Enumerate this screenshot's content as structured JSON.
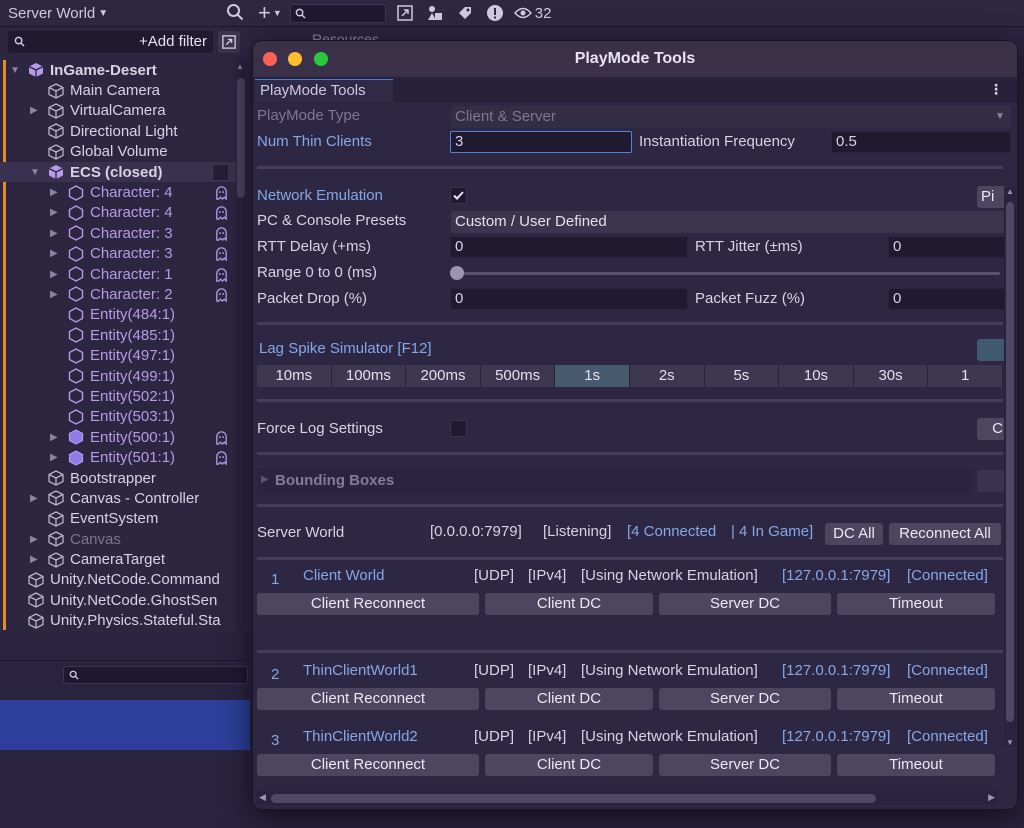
{
  "hierarchy": {
    "world_title": "Server World",
    "add_filter": "+Add filter",
    "items": [
      {
        "label": "InGame-Desert",
        "kind": "scene"
      },
      {
        "label": "Main Camera",
        "kind": "object"
      },
      {
        "label": "VirtualCamera",
        "kind": "object"
      },
      {
        "label": "Directional Light",
        "kind": "object"
      },
      {
        "label": "Global Volume",
        "kind": "object"
      },
      {
        "label": "ECS  (closed)",
        "kind": "subscene"
      },
      {
        "label": "Character: 4",
        "kind": "entity"
      },
      {
        "label": "Character: 4",
        "kind": "entity"
      },
      {
        "label": "Character: 3",
        "kind": "entity"
      },
      {
        "label": "Character: 3",
        "kind": "entity"
      },
      {
        "label": "Character: 1",
        "kind": "entity"
      },
      {
        "label": "Character: 2",
        "kind": "entity"
      },
      {
        "label": "Entity(484:1)",
        "kind": "entity"
      },
      {
        "label": "Entity(485:1)",
        "kind": "entity"
      },
      {
        "label": "Entity(497:1)",
        "kind": "entity"
      },
      {
        "label": "Entity(499:1)",
        "kind": "entity"
      },
      {
        "label": "Entity(502:1)",
        "kind": "entity"
      },
      {
        "label": "Entity(503:1)",
        "kind": "entity"
      },
      {
        "label": "Entity(500:1)",
        "kind": "entity"
      },
      {
        "label": "Entity(501:1)",
        "kind": "entity"
      },
      {
        "label": "Bootstrapper",
        "kind": "object"
      },
      {
        "label": "Canvas - Controller",
        "kind": "object"
      },
      {
        "label": "EventSystem",
        "kind": "object"
      },
      {
        "label": "Canvas",
        "kind": "object"
      },
      {
        "label": "CameraTarget",
        "kind": "object"
      },
      {
        "label": "Unity.NetCode.Command",
        "kind": "object"
      },
      {
        "label": "Unity.NetCode.GhostSen",
        "kind": "object"
      },
      {
        "label": "Unity.Physics.Stateful.Sta",
        "kind": "object"
      }
    ]
  },
  "toolbar": {
    "count": "32",
    "resources_label": "Resources"
  },
  "window": {
    "title": "PlayMode Tools",
    "tab": "PlayMode Tools"
  },
  "playmode": {
    "type_label": "PlayMode Type",
    "type_value": "Client & Server",
    "num_thin_label": "Num Thin Clients",
    "num_thin_value": "3",
    "inst_freq_label": "Instantiation Frequency",
    "inst_freq_value": "0.5"
  },
  "network": {
    "emulation_label": "Network Emulation",
    "emulation_enabled": true,
    "ping_button": "Pi",
    "presets_label": "PC & Console Presets",
    "presets_value": "Custom / User Defined",
    "rtt_delay_label": "RTT Delay (+ms)",
    "rtt_delay_value": "0",
    "rtt_jitter_label": "RTT Jitter (±ms)",
    "rtt_jitter_value": "0",
    "range_label": "Range 0 to 0 (ms)",
    "packet_drop_label": "Packet Drop (%)",
    "packet_drop_value": "0",
    "packet_fuzz_label": "Packet Fuzz (%)",
    "packet_fuzz_value": "0"
  },
  "lag_spike": {
    "label": "Lag Spike Simulator [F12]",
    "options": [
      "10ms",
      "100ms",
      "200ms",
      "500ms",
      "1s",
      "2s",
      "5s",
      "10s",
      "30s",
      "1"
    ],
    "selected": "1s"
  },
  "log": {
    "label": "Force Log Settings",
    "button": "C"
  },
  "bounding": {
    "label": "Bounding Boxes"
  },
  "server": {
    "label": "Server World",
    "address": "[0.0.0.0:7979]",
    "status": "[Listening]",
    "connected": "[4 Connected",
    "sep": "|",
    "ingame": "4 In Game]",
    "dc_all": "DC All",
    "reconnect_all": "Reconnect All"
  },
  "clients": [
    {
      "index": "1",
      "name": "Client World",
      "transport": "[UDP]",
      "ip": "[IPv4]",
      "emulation": "[Using Network Emulation]",
      "endpoint": "[127.0.0.1:7979]",
      "status": "[Connected]"
    },
    {
      "index": "2",
      "name": "ThinClientWorld1",
      "transport": "[UDP]",
      "ip": "[IPv4]",
      "emulation": "[Using Network Emulation]",
      "endpoint": "[127.0.0.1:7979]",
      "status": "[Connected]"
    },
    {
      "index": "3",
      "name": "ThinClientWorld2",
      "transport": "[UDP]",
      "ip": "[IPv4]",
      "emulation": "[Using Network Emulation]",
      "endpoint": "[127.0.0.1:7979]",
      "status": "[Connected]"
    }
  ],
  "client_buttons": {
    "reconnect": "Client Reconnect",
    "client_dc": "Client DC",
    "server_dc": "Server DC",
    "timeout": "Timeout"
  },
  "colors": {
    "accent_blue": "#84a8e6",
    "entity_purple": "#b69ae8",
    "selected_segment": "#47596e",
    "play_orange": "#e48a2a"
  }
}
